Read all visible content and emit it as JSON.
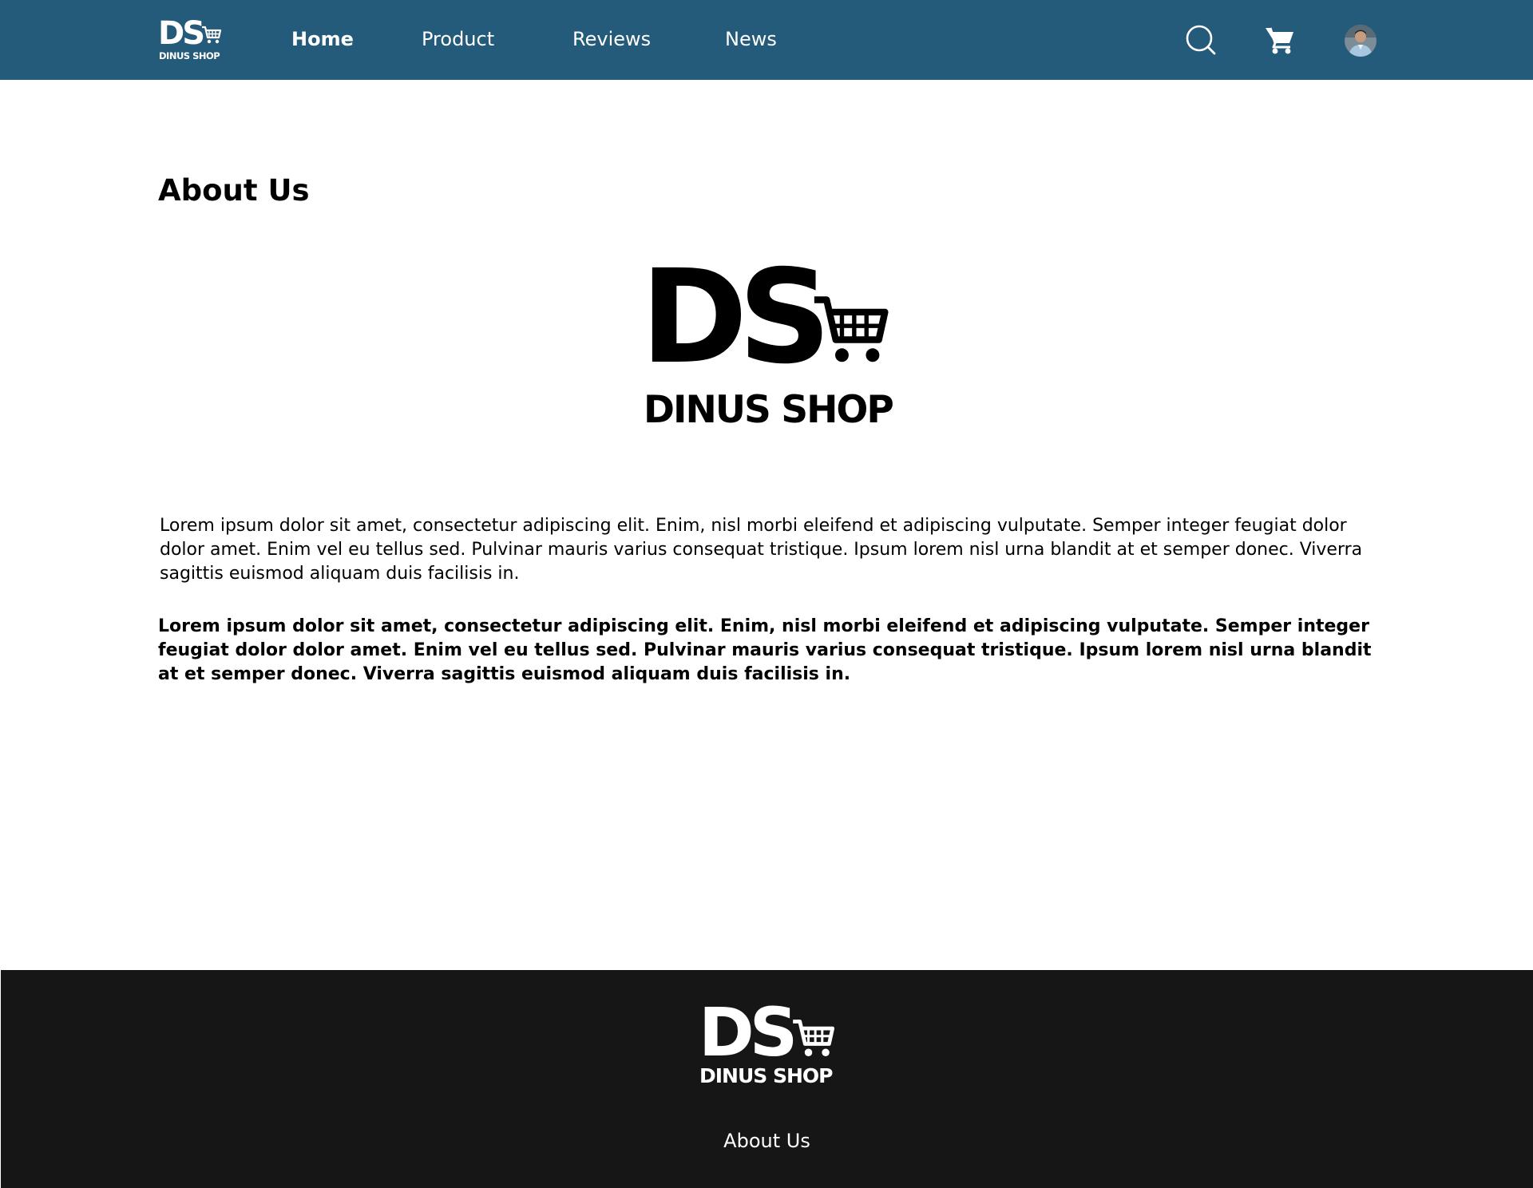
{
  "brand": {
    "initials": "DS",
    "name": "DINUS SHOP"
  },
  "nav": {
    "items": [
      {
        "label": "Home",
        "active": true
      },
      {
        "label": "Product",
        "active": false
      },
      {
        "label": "Reviews",
        "active": false
      },
      {
        "label": "News",
        "active": false
      }
    ],
    "icons": [
      "search-icon",
      "cart-icon",
      "user-avatar"
    ]
  },
  "main": {
    "title": "About Us",
    "paragraphs": [
      "Lorem ipsum dolor sit amet, consectetur adipiscing elit. Enim, nisl morbi eleifend et adipiscing vulputate. Semper integer feugiat dolor dolor amet. Enim vel eu tellus sed. Pulvinar mauris varius consequat tristique. Ipsum lorem nisl urna blandit at et semper donec. Viverra sagittis euismod aliquam duis facilisis in.",
      "Lorem ipsum dolor sit amet, consectetur adipiscing elit. Enim, nisl morbi eleifend et adipiscing vulputate. Semper integer feugiat dolor dolor amet. Enim vel eu tellus sed. Pulvinar mauris varius consequat tristique. Ipsum lorem nisl urna blandit at et semper donec. Viverra sagittis euismod aliquam duis facilisis in."
    ]
  },
  "footer": {
    "link": "About Us"
  },
  "colors": {
    "header_bg": "#245a7a",
    "footer_bg": "#161616",
    "text": "#000000",
    "nav_text": "#ffffff"
  }
}
